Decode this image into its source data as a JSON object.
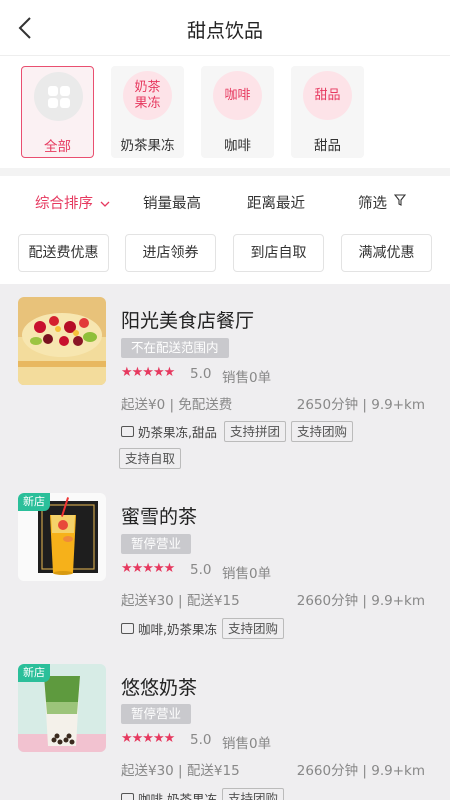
{
  "header": {
    "title": "甜点饮品"
  },
  "categories": [
    {
      "icon": "grid-icon",
      "circle_text": "",
      "label": "全部",
      "active": true
    },
    {
      "circle_text": "奶茶果冻",
      "label": "奶茶果冻"
    },
    {
      "circle_text": "咖啡",
      "label": "咖啡"
    },
    {
      "circle_text": "甜品",
      "label": "甜品"
    }
  ],
  "sort_tabs": [
    {
      "label": "综合排序",
      "active": true,
      "icon": "chevron-down-icon"
    },
    {
      "label": "销量最高"
    },
    {
      "label": "距离最近"
    },
    {
      "label": "筛选",
      "icon": "filter-icon"
    }
  ],
  "filter_chips": [
    "配送费优惠",
    "进店领券",
    "到店自取",
    "满减优惠"
  ],
  "stores": [
    {
      "name": "阳光美食店餐厅",
      "status": "不在配送范围内",
      "stars": "★★★★★",
      "rating": "5.0",
      "sales": "销售0单",
      "delivery": "起送¥0 | 免配送费",
      "distance": "2650分钟 | 9.9+km",
      "categories": "奶茶果冻,甜品",
      "tags": [
        "支持拼团",
        "支持团购"
      ],
      "tag2": "支持自取",
      "is_new": false
    },
    {
      "name": "蜜雪的茶",
      "status": "暂停营业",
      "stars": "★★★★★",
      "rating": "5.0",
      "sales": "销售0单",
      "delivery": "起送¥30 | 配送¥15",
      "distance": "2660分钟 | 9.9+km",
      "categories": "咖啡,奶茶果冻",
      "tags": [
        "支持团购"
      ],
      "is_new": true,
      "new_label": "新店"
    },
    {
      "name": "悠悠奶茶",
      "status": "暂停营业",
      "stars": "★★★★★",
      "rating": "5.0",
      "sales": "销售0单",
      "delivery": "起送¥30 | 配送¥15",
      "distance": "2660分钟 | 9.9+km",
      "categories": "咖啡,奶茶果冻",
      "tags": [
        "支持团购"
      ],
      "is_new": true,
      "new_label": "新店"
    }
  ],
  "colors": {
    "accent": "#e6395f",
    "new_badge": "#2bbf9a"
  }
}
